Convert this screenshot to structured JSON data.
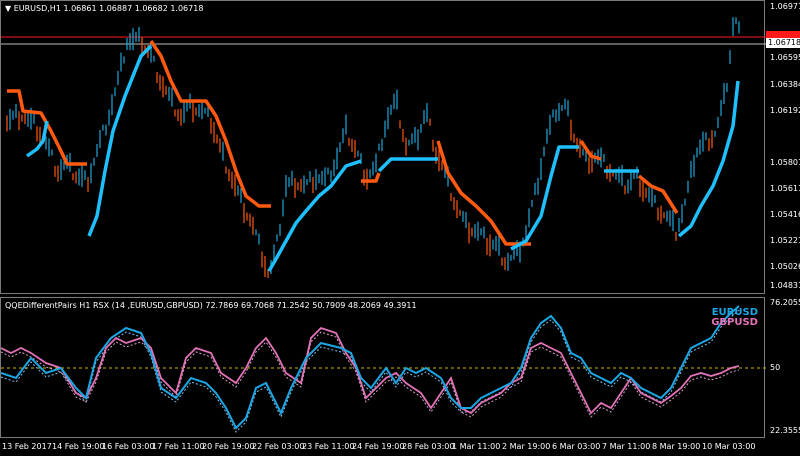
{
  "main_chart": {
    "header": "EURUSD,H1  1.06861 1.06887 1.06682 1.06718",
    "price_labels": [
      "1.06971",
      "1.06718",
      "1.06595",
      "1.06384",
      "1.06192",
      "1.05801",
      "1.05611",
      "1.05416",
      "1.05221",
      "1.05026",
      "1.04831"
    ],
    "current_price": "1.06718",
    "colors": {
      "up": "#1ea6d9",
      "down": "#ff5a0f",
      "trend_up": "#1fc0ff",
      "trend_down": "#ff5a0f",
      "line_red": "#ff1a1a",
      "line_grey": "#bdbdbd"
    }
  },
  "sub_chart": {
    "header": "QQEDifferentPairs H1 RSX (14 ,EURUSD,GBPUSD)  72.7869 69.7068 71.2542 50.7909 48.2069 49.3911",
    "labels": [
      "76.2055",
      "50",
      "22.3555"
    ],
    "legend": [
      {
        "text": "EURUSD",
        "color": "#1ba6e4"
      },
      {
        "text": "GBPUSD",
        "color": "#e373b8"
      }
    ]
  },
  "time_axis": [
    "13 Feb 2017",
    "14 Feb 19:00",
    "16 Feb 03:00",
    "17 Feb 11:00",
    "20 Feb 19:00",
    "22 Feb 03:00",
    "23 Feb 11:00",
    "24 Feb 19:00",
    "28 Feb 03:00",
    "1 Mar 11:00",
    "2 Mar 19:00",
    "6 Mar 03:00",
    "7 Mar 11:00",
    "8 Mar 19:00",
    "10 Mar 03:00"
  ]
}
